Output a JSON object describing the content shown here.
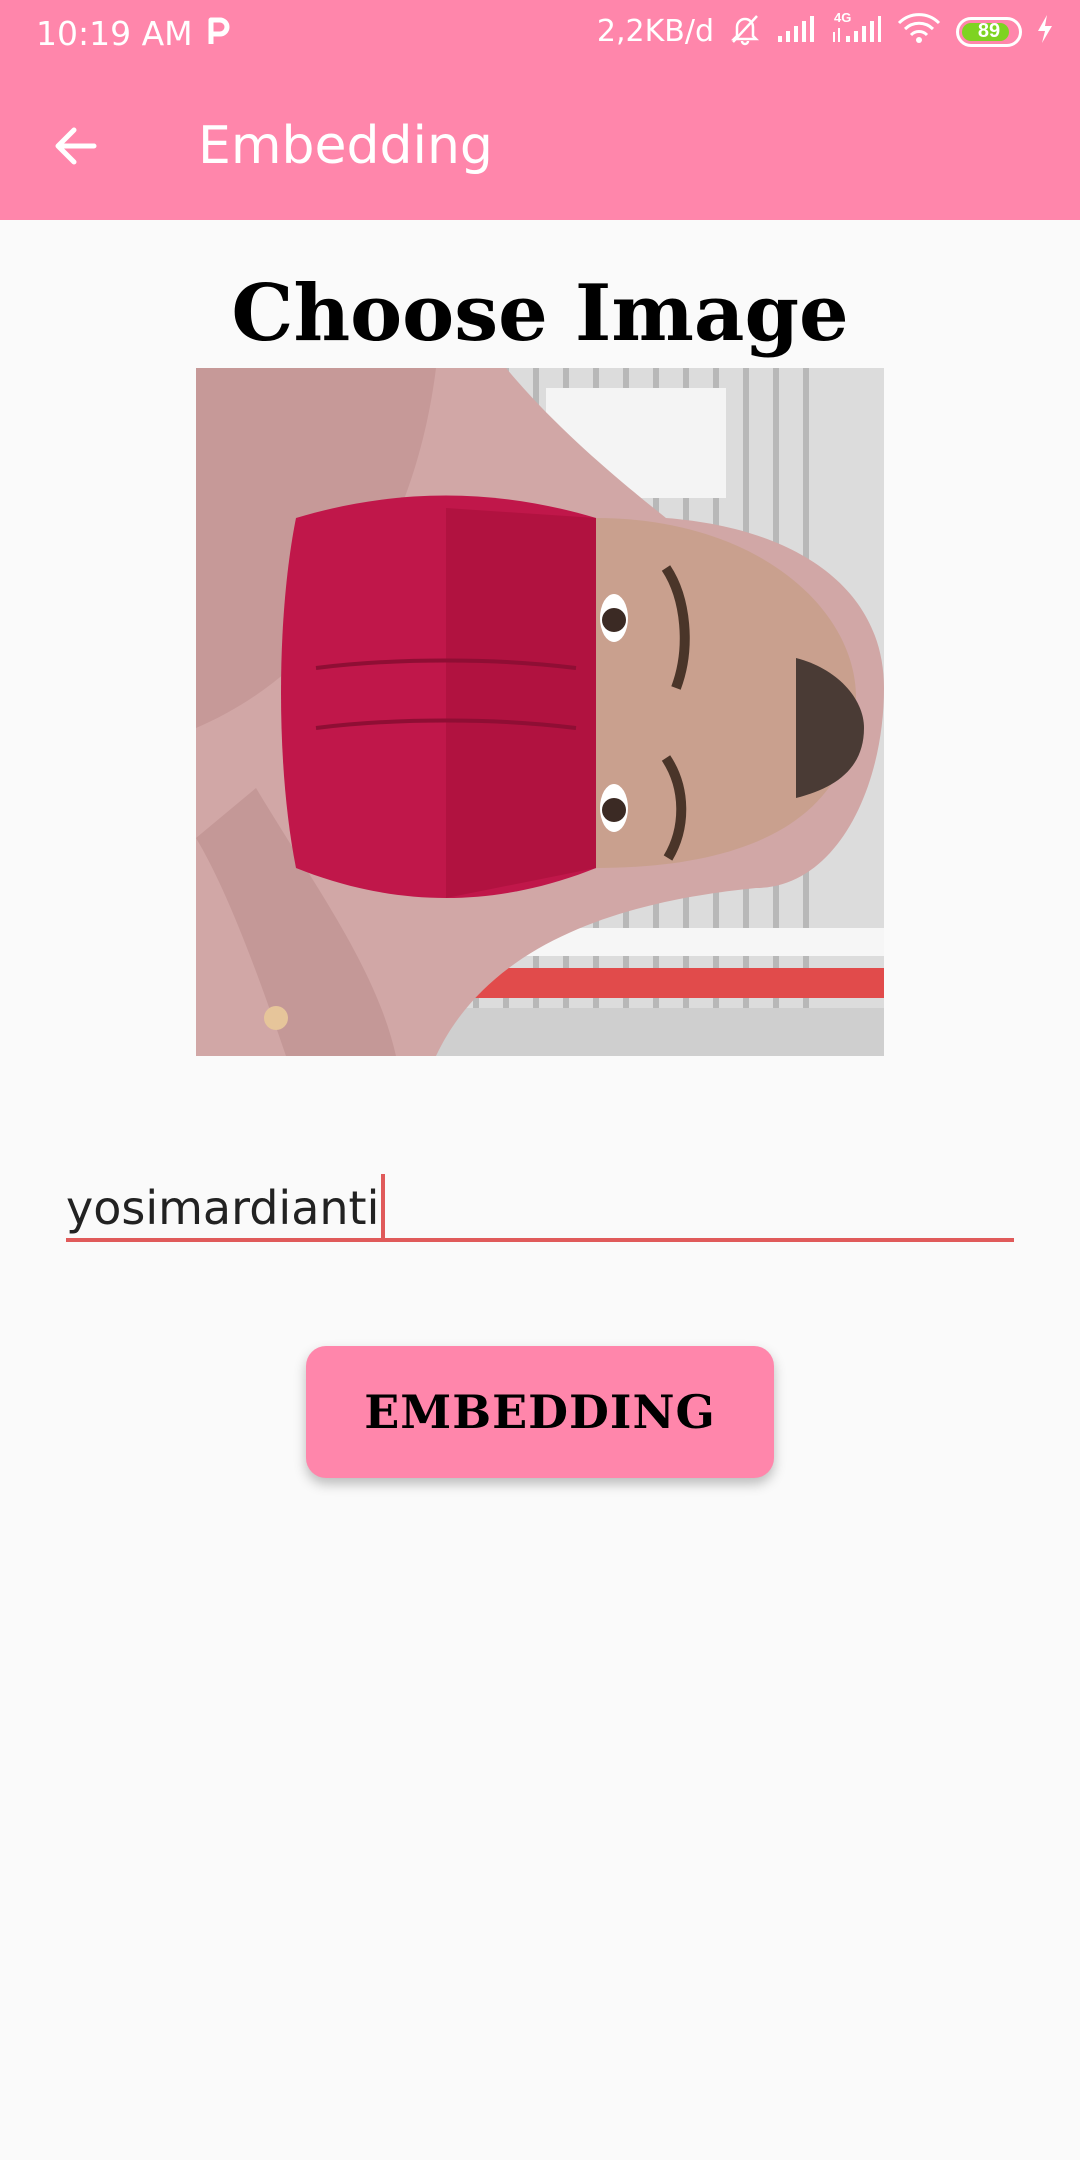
{
  "status_bar": {
    "time": "10:19 AM",
    "net_speed": "2,2KB/d",
    "network_label": "4G",
    "battery_level": 89,
    "battery_text": "89",
    "icons": [
      "parking-p-icon",
      "mute-bell-icon",
      "signal-icon",
      "signal-4g-icon",
      "wifi-icon",
      "battery-icon",
      "charging-bolt-icon"
    ]
  },
  "app_bar": {
    "title": "Embedding",
    "back_icon": "arrow-left-icon"
  },
  "main": {
    "heading": "Choose Image",
    "name_field": {
      "value": "yosimardianti"
    },
    "embed_button": {
      "label": "EMBEDDING"
    }
  },
  "colors": {
    "accent": "#ff86ab",
    "underline": "#e05a5a",
    "background": "#fafafa",
    "battery_fill": "#7ed321"
  }
}
